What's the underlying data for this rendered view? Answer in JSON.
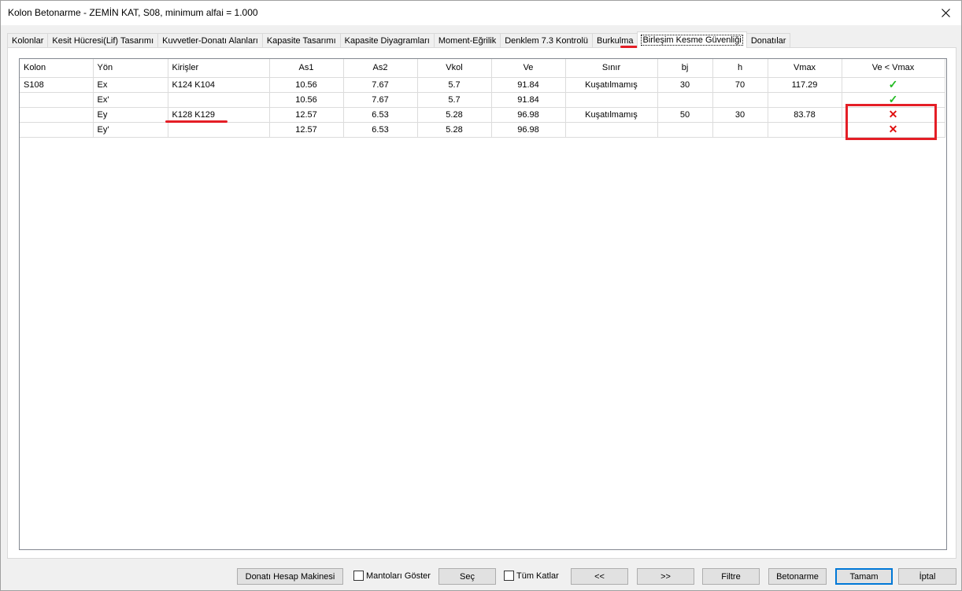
{
  "window": {
    "title": "Kolon Betonarme - ZEMİN KAT, S08, minimum alfai = 1.000"
  },
  "tabs": [
    {
      "label": "Kolonlar"
    },
    {
      "label": "Kesit Hücresi(Lif) Tasarımı"
    },
    {
      "label": "Kuvvetler-Donatı Alanları"
    },
    {
      "label": "Kapasite Tasarımı"
    },
    {
      "label": "Kapasite Diyagramları"
    },
    {
      "label": "Moment-Eğrilik"
    },
    {
      "label": "Denklem 7.3 Kontrolü"
    },
    {
      "label": "Burkulma"
    },
    {
      "label": "Birleşim Kesme Güvenliği"
    },
    {
      "label": "Donatılar"
    }
  ],
  "active_tab": "Birleşim Kesme Güvenliği",
  "table": {
    "headers": [
      "Kolon",
      "Yön",
      "Kirişler",
      "As1",
      "As2",
      "Vkol",
      "Ve",
      "Sınır",
      "bj",
      "h",
      "Vmax",
      "Ve < Vmax"
    ],
    "rows": [
      {
        "kolon": "S108",
        "yon": "Ex",
        "kirisler": "K124 K104",
        "as1": "10.56",
        "as2": "7.67",
        "vkol": "5.7",
        "ve": "91.84",
        "sinir": "Kuşatılmamış",
        "bj": "30",
        "h": "70",
        "vmax": "117.29",
        "status": "ok"
      },
      {
        "kolon": "",
        "yon": "Ex'",
        "kirisler": "",
        "as1": "10.56",
        "as2": "7.67",
        "vkol": "5.7",
        "ve": "91.84",
        "sinir": "",
        "bj": "",
        "h": "",
        "vmax": "",
        "status": "ok"
      },
      {
        "kolon": "",
        "yon": "Ey",
        "kirisler": "K128 K129",
        "as1": "12.57",
        "as2": "6.53",
        "vkol": "5.28",
        "ve": "96.98",
        "sinir": "Kuşatılmamış",
        "bj": "50",
        "h": "30",
        "vmax": "83.78",
        "status": "fail"
      },
      {
        "kolon": "",
        "yon": "Ey'",
        "kirisler": "",
        "as1": "12.57",
        "as2": "6.53",
        "vkol": "5.28",
        "ve": "96.98",
        "sinir": "",
        "bj": "",
        "h": "",
        "vmax": "",
        "status": "fail"
      }
    ]
  },
  "buttons": {
    "calculator": "Donatı Hesap Makinesi",
    "show_mantolar": "Mantoları Göster",
    "sec": "Seç",
    "all_floors": "Tüm Katlar",
    "prev": "<<",
    "next": ">>",
    "filtre": "Filtre",
    "betonarme": "Betonarme",
    "tamam": "Tamam",
    "iptal": "İptal"
  },
  "colors": {
    "ok": "#22bb22",
    "fail": "#e01010",
    "annotation": "#e41e26"
  },
  "icons": {
    "ok": "check-icon",
    "fail": "cross-icon"
  }
}
